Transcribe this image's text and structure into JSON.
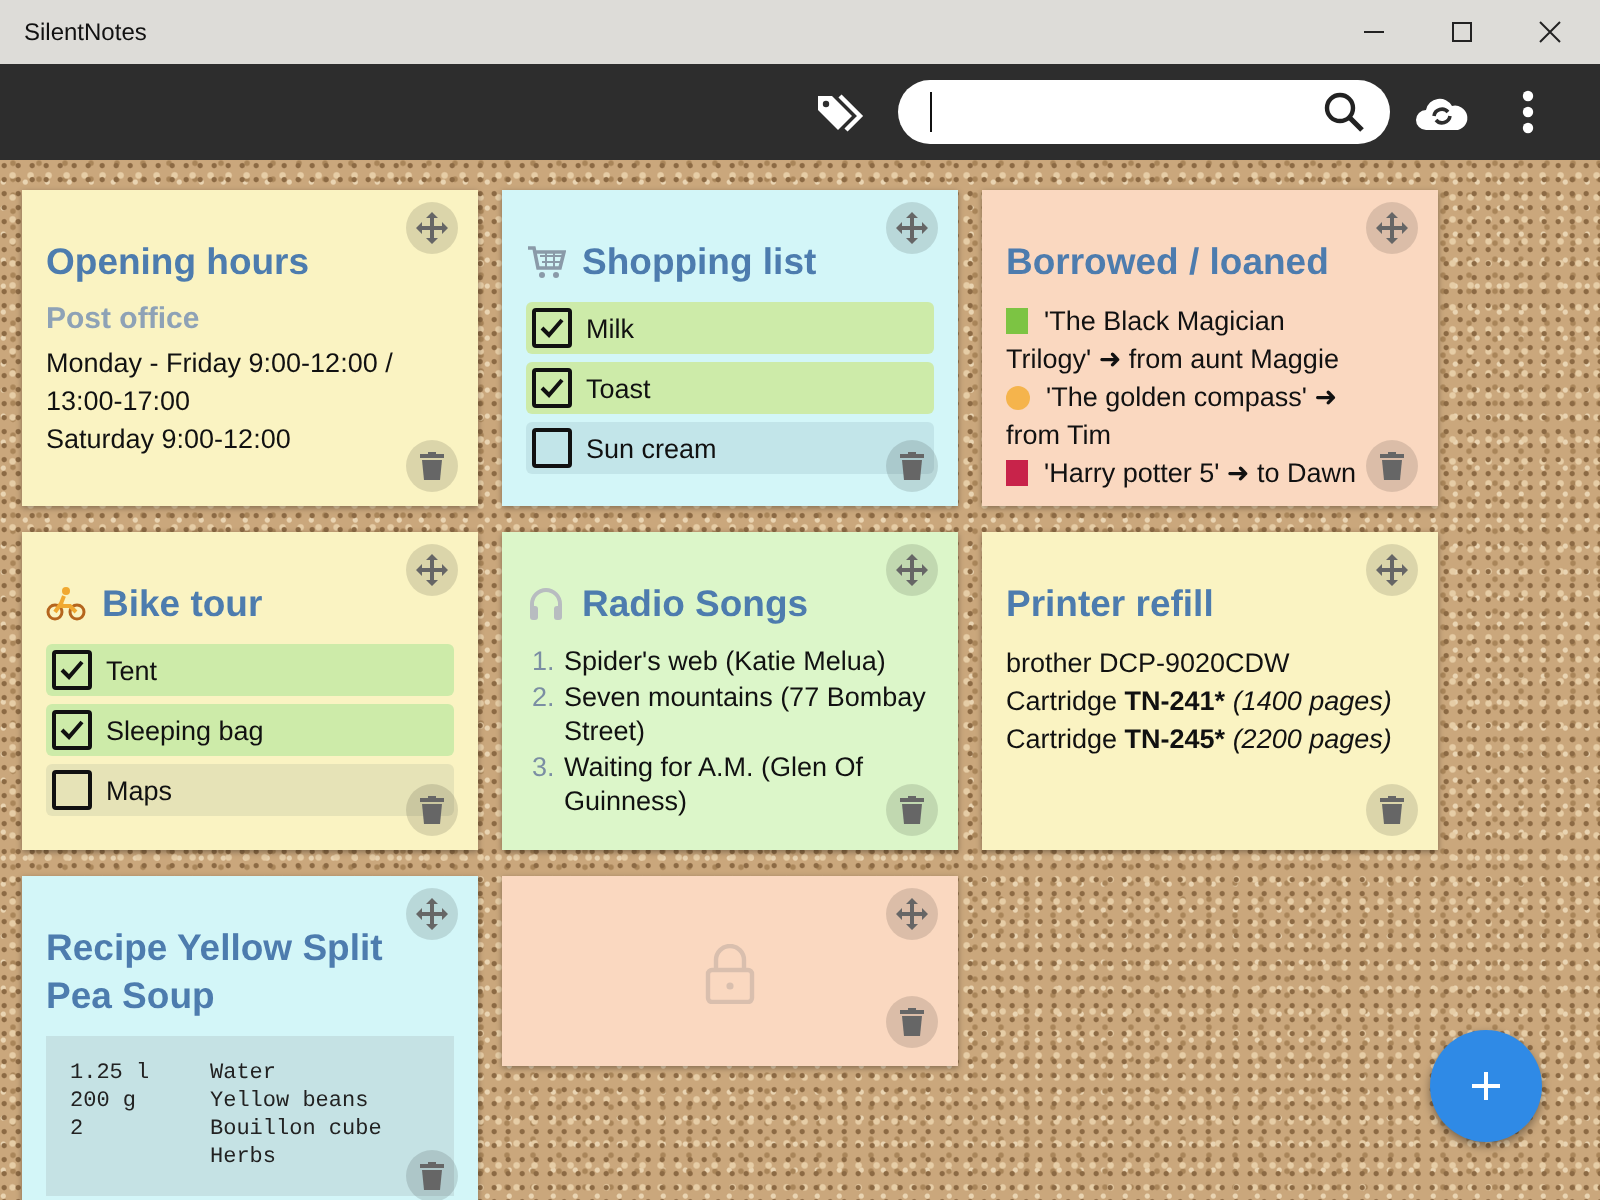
{
  "window": {
    "title": "SilentNotes"
  },
  "notes": [
    {
      "kind": "text",
      "heading": {
        "kind": "plain",
        "text": "Opening hours"
      },
      "color": "#faf3c2",
      "content": [
        {
          "kind": "subheading",
          "text": "Post office"
        },
        {
          "kind": "line",
          "text": "Monday - Friday 9:00-12:00 / 13:00-17:00"
        },
        {
          "kind": "line",
          "text": "Saturday 9:00-12:00"
        }
      ]
    },
    {
      "kind": "checklist",
      "heading": {
        "kind": "cart",
        "text": "Shopping list"
      },
      "color": "#d3f6f8",
      "items": [
        {
          "label": "Milk",
          "checked": true
        },
        {
          "label": "Toast",
          "checked": true
        },
        {
          "label": "Sun cream",
          "checked": false
        }
      ]
    },
    {
      "kind": "borrowed",
      "heading": {
        "kind": "plain",
        "text": "Borrowed / loaned"
      },
      "color": "#fad8c0",
      "items": [
        {
          "kind": "square",
          "color": "#7cc443",
          "text": "'The Black Magician Trilogy' ➜ from aunt Maggie"
        },
        {
          "kind": "circle",
          "color": "#f5b44c",
          "text": "'The golden compass' ➜ from Tim"
        },
        {
          "kind": "square",
          "color": "#c8234a",
          "text": "'Harry potter 5' ➜ to Dawn"
        }
      ]
    },
    {
      "kind": "checklist",
      "heading": {
        "kind": "bike",
        "text": "Bike tour"
      },
      "color": "#faf3c2",
      "items": [
        {
          "label": "Tent",
          "checked": true
        },
        {
          "label": "Sleeping bag",
          "checked": true
        },
        {
          "label": "Maps",
          "checked": false
        }
      ]
    },
    {
      "kind": "numbered",
      "heading": {
        "kind": "headphones",
        "text": "Radio Songs"
      },
      "color": "#dcf6c9",
      "items": [
        {
          "number": "1.",
          "text": "Spider's web (Katie Melua)"
        },
        {
          "number": "2.",
          "text": "Seven mountains (77 Bombay Street)"
        },
        {
          "number": "3.",
          "text": "Waiting for A.M. (Glen Of Guinness)"
        }
      ]
    },
    {
      "kind": "text",
      "heading": {
        "kind": "plain",
        "text": "Printer refill"
      },
      "color": "#faf3c2",
      "content": [
        {
          "kind": "rich",
          "segments": [
            {
              "kind": "plain",
              "text": "brother DCP-9020CDW"
            }
          ]
        },
        {
          "kind": "rich",
          "segments": [
            {
              "kind": "plain",
              "text": "Cartridge "
            },
            {
              "kind": "bold",
              "text": "TN-241*"
            },
            {
              "kind": "italic",
              "text": " (1400 pages)"
            }
          ]
        },
        {
          "kind": "rich",
          "segments": [
            {
              "kind": "plain",
              "text": "Cartridge "
            },
            {
              "kind": "bold",
              "text": "TN-245*"
            },
            {
              "kind": "italic",
              "text": " (2200 pages)"
            }
          ]
        }
      ]
    },
    {
      "kind": "recipe",
      "heading": {
        "kind": "plain",
        "text": "Recipe Yellow Split Pea Soup"
      },
      "color": "#d3f6f8",
      "rows": [
        {
          "amount": "1.25 l",
          "item": "Water"
        },
        {
          "amount": "200 g",
          "item": "Yellow beans"
        },
        {
          "amount": "2",
          "item": "Bouillon cube"
        },
        {
          "amount": "",
          "item": "Herbs"
        }
      ]
    },
    {
      "kind": "locked",
      "color": "#fad8c0",
      "locked": true
    }
  ]
}
